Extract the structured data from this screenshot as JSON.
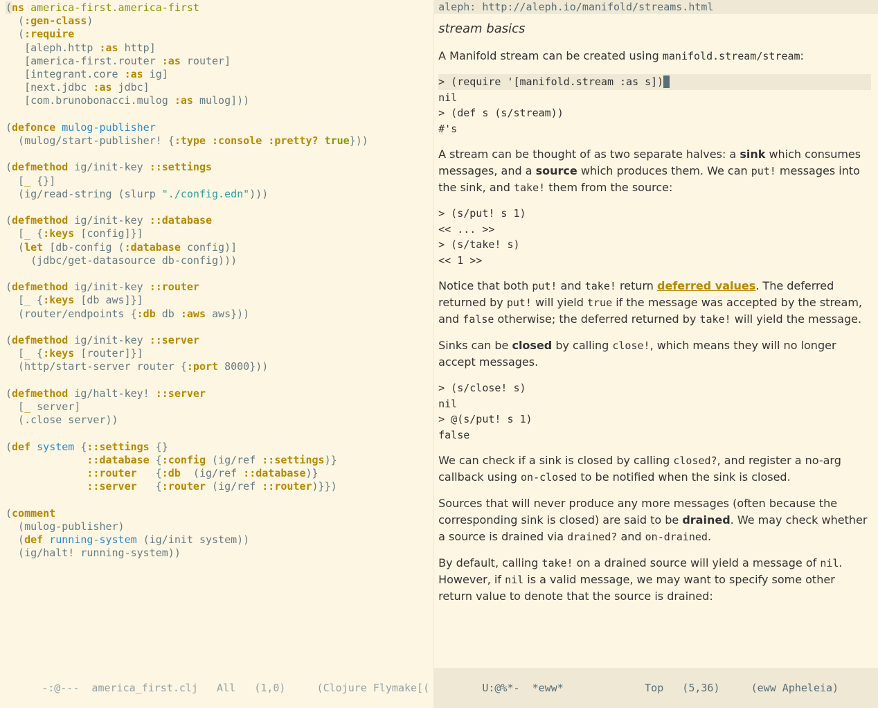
{
  "left_pane": {
    "code_lines": [
      [
        {
          "t": "(",
          "c": "hp"
        },
        {
          "t": "ns",
          "c": "kw"
        },
        {
          "t": " america-first.america-first",
          "c": "ns"
        }
      ],
      [
        {
          "t": "  (",
          "c": ""
        },
        {
          "t": ":gen-class",
          "c": "kw"
        },
        {
          "t": ")",
          "c": ""
        }
      ],
      [
        {
          "t": "  (",
          "c": ""
        },
        {
          "t": ":require",
          "c": "kw"
        }
      ],
      [
        {
          "t": "   [aleph.http ",
          "c": ""
        },
        {
          "t": ":as",
          "c": "kw"
        },
        {
          "t": " http]",
          "c": ""
        }
      ],
      [
        {
          "t": "   [america-first.router ",
          "c": ""
        },
        {
          "t": ":as",
          "c": "kw"
        },
        {
          "t": " router]",
          "c": ""
        }
      ],
      [
        {
          "t": "   [integrant.core ",
          "c": ""
        },
        {
          "t": ":as",
          "c": "kw"
        },
        {
          "t": " ig]",
          "c": ""
        }
      ],
      [
        {
          "t": "   [next.jdbc ",
          "c": ""
        },
        {
          "t": ":as",
          "c": "kw"
        },
        {
          "t": " jdbc]",
          "c": ""
        }
      ],
      [
        {
          "t": "   [com.brunobonacci.mulog ",
          "c": ""
        },
        {
          "t": ":as",
          "c": "kw"
        },
        {
          "t": " mulog]))",
          "c": ""
        }
      ],
      [
        {
          "t": " ",
          "c": ""
        }
      ],
      [
        {
          "t": "(",
          "c": ""
        },
        {
          "t": "defonce",
          "c": "kw"
        },
        {
          "t": " ",
          "c": ""
        },
        {
          "t": "mulog-publisher",
          "c": "def"
        }
      ],
      [
        {
          "t": "  (mulog",
          "c": ""
        },
        {
          "t": "/start-publisher! {",
          "c": ""
        },
        {
          "t": ":type",
          "c": "kw"
        },
        {
          "t": " ",
          "c": ""
        },
        {
          "t": ":console",
          "c": "kw"
        },
        {
          "t": " ",
          "c": ""
        },
        {
          "t": ":pretty?",
          "c": "kw"
        },
        {
          "t": " ",
          "c": ""
        },
        {
          "t": "true",
          "c": "cnst"
        },
        {
          "t": "}))",
          "c": ""
        }
      ],
      [
        {
          "t": " ",
          "c": ""
        }
      ],
      [
        {
          "t": "(",
          "c": ""
        },
        {
          "t": "defmethod",
          "c": "kw"
        },
        {
          "t": " ig/init-key ",
          "c": ""
        },
        {
          "t": "::settings",
          "c": "kw"
        }
      ],
      [
        {
          "t": "  [",
          "c": ""
        },
        {
          "t": "_",
          "c": "kwnb"
        },
        {
          "t": " {}]",
          "c": ""
        }
      ],
      [
        {
          "t": "  (ig",
          "c": ""
        },
        {
          "t": "/read-string (slurp ",
          "c": ""
        },
        {
          "t": "\"./config.edn\"",
          "c": "str"
        },
        {
          "t": ")))",
          "c": ""
        }
      ],
      [
        {
          "t": " ",
          "c": ""
        }
      ],
      [
        {
          "t": "(",
          "c": ""
        },
        {
          "t": "defmethod",
          "c": "kw"
        },
        {
          "t": " ig/init-key ",
          "c": ""
        },
        {
          "t": "::database",
          "c": "kw"
        }
      ],
      [
        {
          "t": "  [",
          "c": ""
        },
        {
          "t": "_",
          "c": "kwnb"
        },
        {
          "t": " {",
          "c": ""
        },
        {
          "t": ":keys",
          "c": "kw"
        },
        {
          "t": " [config]}]",
          "c": ""
        }
      ],
      [
        {
          "t": "  (",
          "c": ""
        },
        {
          "t": "let",
          "c": "kw"
        },
        {
          "t": " [db-config (",
          "c": ""
        },
        {
          "t": ":database",
          "c": "kw"
        },
        {
          "t": " config)]",
          "c": ""
        }
      ],
      [
        {
          "t": "    (jdbc",
          "c": ""
        },
        {
          "t": "/get-datasource db-config)))",
          "c": ""
        }
      ],
      [
        {
          "t": " ",
          "c": ""
        }
      ],
      [
        {
          "t": "(",
          "c": ""
        },
        {
          "t": "defmethod",
          "c": "kw"
        },
        {
          "t": " ig/init-key ",
          "c": ""
        },
        {
          "t": "::router",
          "c": "kw"
        }
      ],
      [
        {
          "t": "  [",
          "c": ""
        },
        {
          "t": "_",
          "c": "kwnb"
        },
        {
          "t": " {",
          "c": ""
        },
        {
          "t": ":keys",
          "c": "kw"
        },
        {
          "t": " [db aws]}]",
          "c": ""
        }
      ],
      [
        {
          "t": "  (router",
          "c": ""
        },
        {
          "t": "/endpoints {",
          "c": ""
        },
        {
          "t": ":db",
          "c": "kw"
        },
        {
          "t": " db ",
          "c": ""
        },
        {
          "t": ":aws",
          "c": "kw"
        },
        {
          "t": " aws}))",
          "c": ""
        }
      ],
      [
        {
          "t": " ",
          "c": ""
        }
      ],
      [
        {
          "t": "(",
          "c": ""
        },
        {
          "t": "defmethod",
          "c": "kw"
        },
        {
          "t": " ig/init-key ",
          "c": ""
        },
        {
          "t": "::server",
          "c": "kw"
        }
      ],
      [
        {
          "t": "  [",
          "c": ""
        },
        {
          "t": "_",
          "c": "kwnb"
        },
        {
          "t": " {",
          "c": ""
        },
        {
          "t": ":keys",
          "c": "kw"
        },
        {
          "t": " [router]}]",
          "c": ""
        }
      ],
      [
        {
          "t": "  (http",
          "c": ""
        },
        {
          "t": "/start-server router {",
          "c": ""
        },
        {
          "t": ":port",
          "c": "kw"
        },
        {
          "t": " 8000}))",
          "c": ""
        }
      ],
      [
        {
          "t": " ",
          "c": ""
        }
      ],
      [
        {
          "t": "(",
          "c": ""
        },
        {
          "t": "defmethod",
          "c": "kw"
        },
        {
          "t": " ig/halt-key! ",
          "c": ""
        },
        {
          "t": "::server",
          "c": "kw"
        }
      ],
      [
        {
          "t": "  [",
          "c": ""
        },
        {
          "t": "_",
          "c": "kwnb"
        },
        {
          "t": " server]",
          "c": ""
        }
      ],
      [
        {
          "t": "  (.close server))",
          "c": ""
        }
      ],
      [
        {
          "t": " ",
          "c": ""
        }
      ],
      [
        {
          "t": "(",
          "c": ""
        },
        {
          "t": "def",
          "c": "kw"
        },
        {
          "t": " ",
          "c": ""
        },
        {
          "t": "system",
          "c": "def"
        },
        {
          "t": " {",
          "c": ""
        },
        {
          "t": "::settings",
          "c": "kw"
        },
        {
          "t": " {}",
          "c": ""
        }
      ],
      [
        {
          "t": "             ",
          "c": ""
        },
        {
          "t": "::database",
          "c": "kw"
        },
        {
          "t": " {",
          "c": ""
        },
        {
          "t": ":config",
          "c": "kw"
        },
        {
          "t": " (ig",
          "c": ""
        },
        {
          "t": "/ref ",
          "c": ""
        },
        {
          "t": "::settings",
          "c": "kw"
        },
        {
          "t": ")}",
          "c": ""
        }
      ],
      [
        {
          "t": "             ",
          "c": ""
        },
        {
          "t": "::router",
          "c": "kw"
        },
        {
          "t": "   {",
          "c": ""
        },
        {
          "t": ":db",
          "c": "kw"
        },
        {
          "t": "  (ig",
          "c": ""
        },
        {
          "t": "/ref ",
          "c": ""
        },
        {
          "t": "::database",
          "c": "kw"
        },
        {
          "t": ")}",
          "c": ""
        }
      ],
      [
        {
          "t": "             ",
          "c": ""
        },
        {
          "t": "::server",
          "c": "kw"
        },
        {
          "t": "   {",
          "c": ""
        },
        {
          "t": ":router",
          "c": "kw"
        },
        {
          "t": " (ig",
          "c": ""
        },
        {
          "t": "/ref ",
          "c": ""
        },
        {
          "t": "::router",
          "c": "kw"
        },
        {
          "t": ")}})",
          "c": ""
        }
      ],
      [
        {
          "t": " ",
          "c": ""
        }
      ],
      [
        {
          "t": "(",
          "c": ""
        },
        {
          "t": "comment",
          "c": "kw"
        }
      ],
      [
        {
          "t": "  (mulog-publisher)",
          "c": ""
        }
      ],
      [
        {
          "t": "  (",
          "c": ""
        },
        {
          "t": "def",
          "c": "kw"
        },
        {
          "t": " ",
          "c": ""
        },
        {
          "t": "running-system",
          "c": "def"
        },
        {
          "t": " (ig",
          "c": ""
        },
        {
          "t": "/init system))",
          "c": ""
        }
      ],
      [
        {
          "t": "  (ig",
          "c": ""
        },
        {
          "t": "/halt! running-system))",
          "c": ""
        }
      ]
    ],
    "modeline": "-:@---  america_first.clj   All   (1,0)     (Clojure Flymake[("
  },
  "right_pane": {
    "url_bar": "aleph:  http://aleph.io/manifold/streams.html",
    "title": "stream basics",
    "para1_pre": "A Manifold stream can be created using ",
    "para1_code": "manifold.stream/stream",
    "para1_post": ":",
    "code1_hl": "> (require '[manifold.stream :as s])",
    "code1_rest": "nil\n> (def s (s/stream))\n#'s",
    "para2_a": "A stream can be thought of as two separate halves: a ",
    "para2_sink": "sink",
    "para2_b": " which consumes messages, and a ",
    "para2_source": "source",
    "para2_c": " which produces them. We can ",
    "para2_put": "put!",
    "para2_d": " messages into the sink, and ",
    "para2_take": "take!",
    "para2_e": " them from the source:",
    "code2": "> (s/put! s 1)\n<< ... >>\n> (s/take! s)\n<< 1 >>",
    "para3_a": "Notice that both ",
    "para3_put": "put!",
    "para3_b": " and ",
    "para3_take": "take!",
    "para3_c": " return ",
    "para3_link": "deferred values",
    "para3_d": ". The deferred returned by ",
    "para3_put2": "put!",
    "para3_e": " will yield ",
    "para3_true": "true",
    "para3_f": " if the message was accepted by the stream, and ",
    "para3_false": "false",
    "para3_g": " otherwise; the deferred returned by ",
    "para3_take2": "take!",
    "para3_h": " will yield the message.",
    "para4_a": "Sinks can be ",
    "para4_closed": "closed",
    "para4_b": " by calling ",
    "para4_closefn": "close!",
    "para4_c": ", which means they will no longer accept messages.",
    "code3": "> (s/close! s)\nnil\n> @(s/put! s 1)\nfalse",
    "para5_a": "We can check if a sink is closed by calling ",
    "para5_closedq": "closed?",
    "para5_b": ", and register a no-arg callback using ",
    "para5_onclosed": "on-closed",
    "para5_c": " to be notified when the sink is closed.",
    "para6_a": "Sources that will never produce any more messages (often because the corresponding sink is closed) are said to be ",
    "para6_drained": "drained",
    "para6_b": ". We may check whether a source is drained via ",
    "para6_drainedq": "drained?",
    "para6_c": " and ",
    "para6_ondrained": "on-drained",
    "para6_d": ".",
    "para7_a": "By default, calling ",
    "para7_take": "take!",
    "para7_b": " on a drained source will yield a message of ",
    "para7_nil": "nil",
    "para7_c": ". However, if ",
    "para7_nil2": "nil",
    "para7_d": " is a valid message, we may want to specify some other return value to denote that the source is drained:",
    "modeline": " U:@%*-  *eww*             Top   (5,36)     (eww Apheleia)   "
  }
}
